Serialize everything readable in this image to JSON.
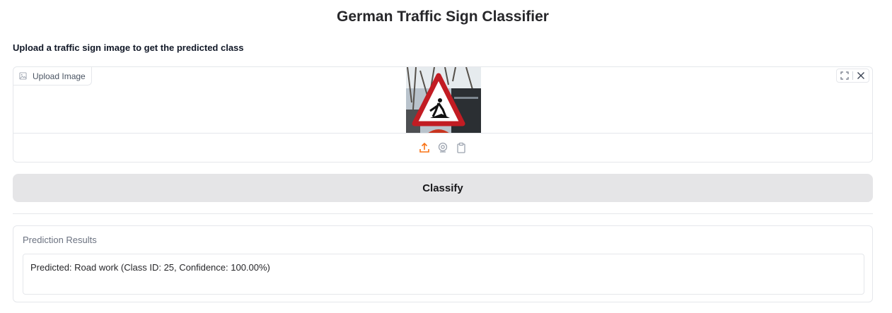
{
  "header": {
    "title": "German Traffic Sign Classifier",
    "description": "Upload a traffic sign image to get the predicted class"
  },
  "image_input": {
    "label": "Upload Image",
    "icons": {
      "label_icon": "image-icon",
      "fullscreen": "fullscreen-icon",
      "clear": "close-icon",
      "sources": [
        "upload-icon",
        "webcam-icon",
        "clipboard-icon"
      ]
    },
    "active_source_color": "#f97316"
  },
  "action": {
    "classify_label": "Classify"
  },
  "output": {
    "label": "Prediction Results",
    "value": "Predicted: Road work (Class ID: 25, Confidence: 100.00%)"
  }
}
